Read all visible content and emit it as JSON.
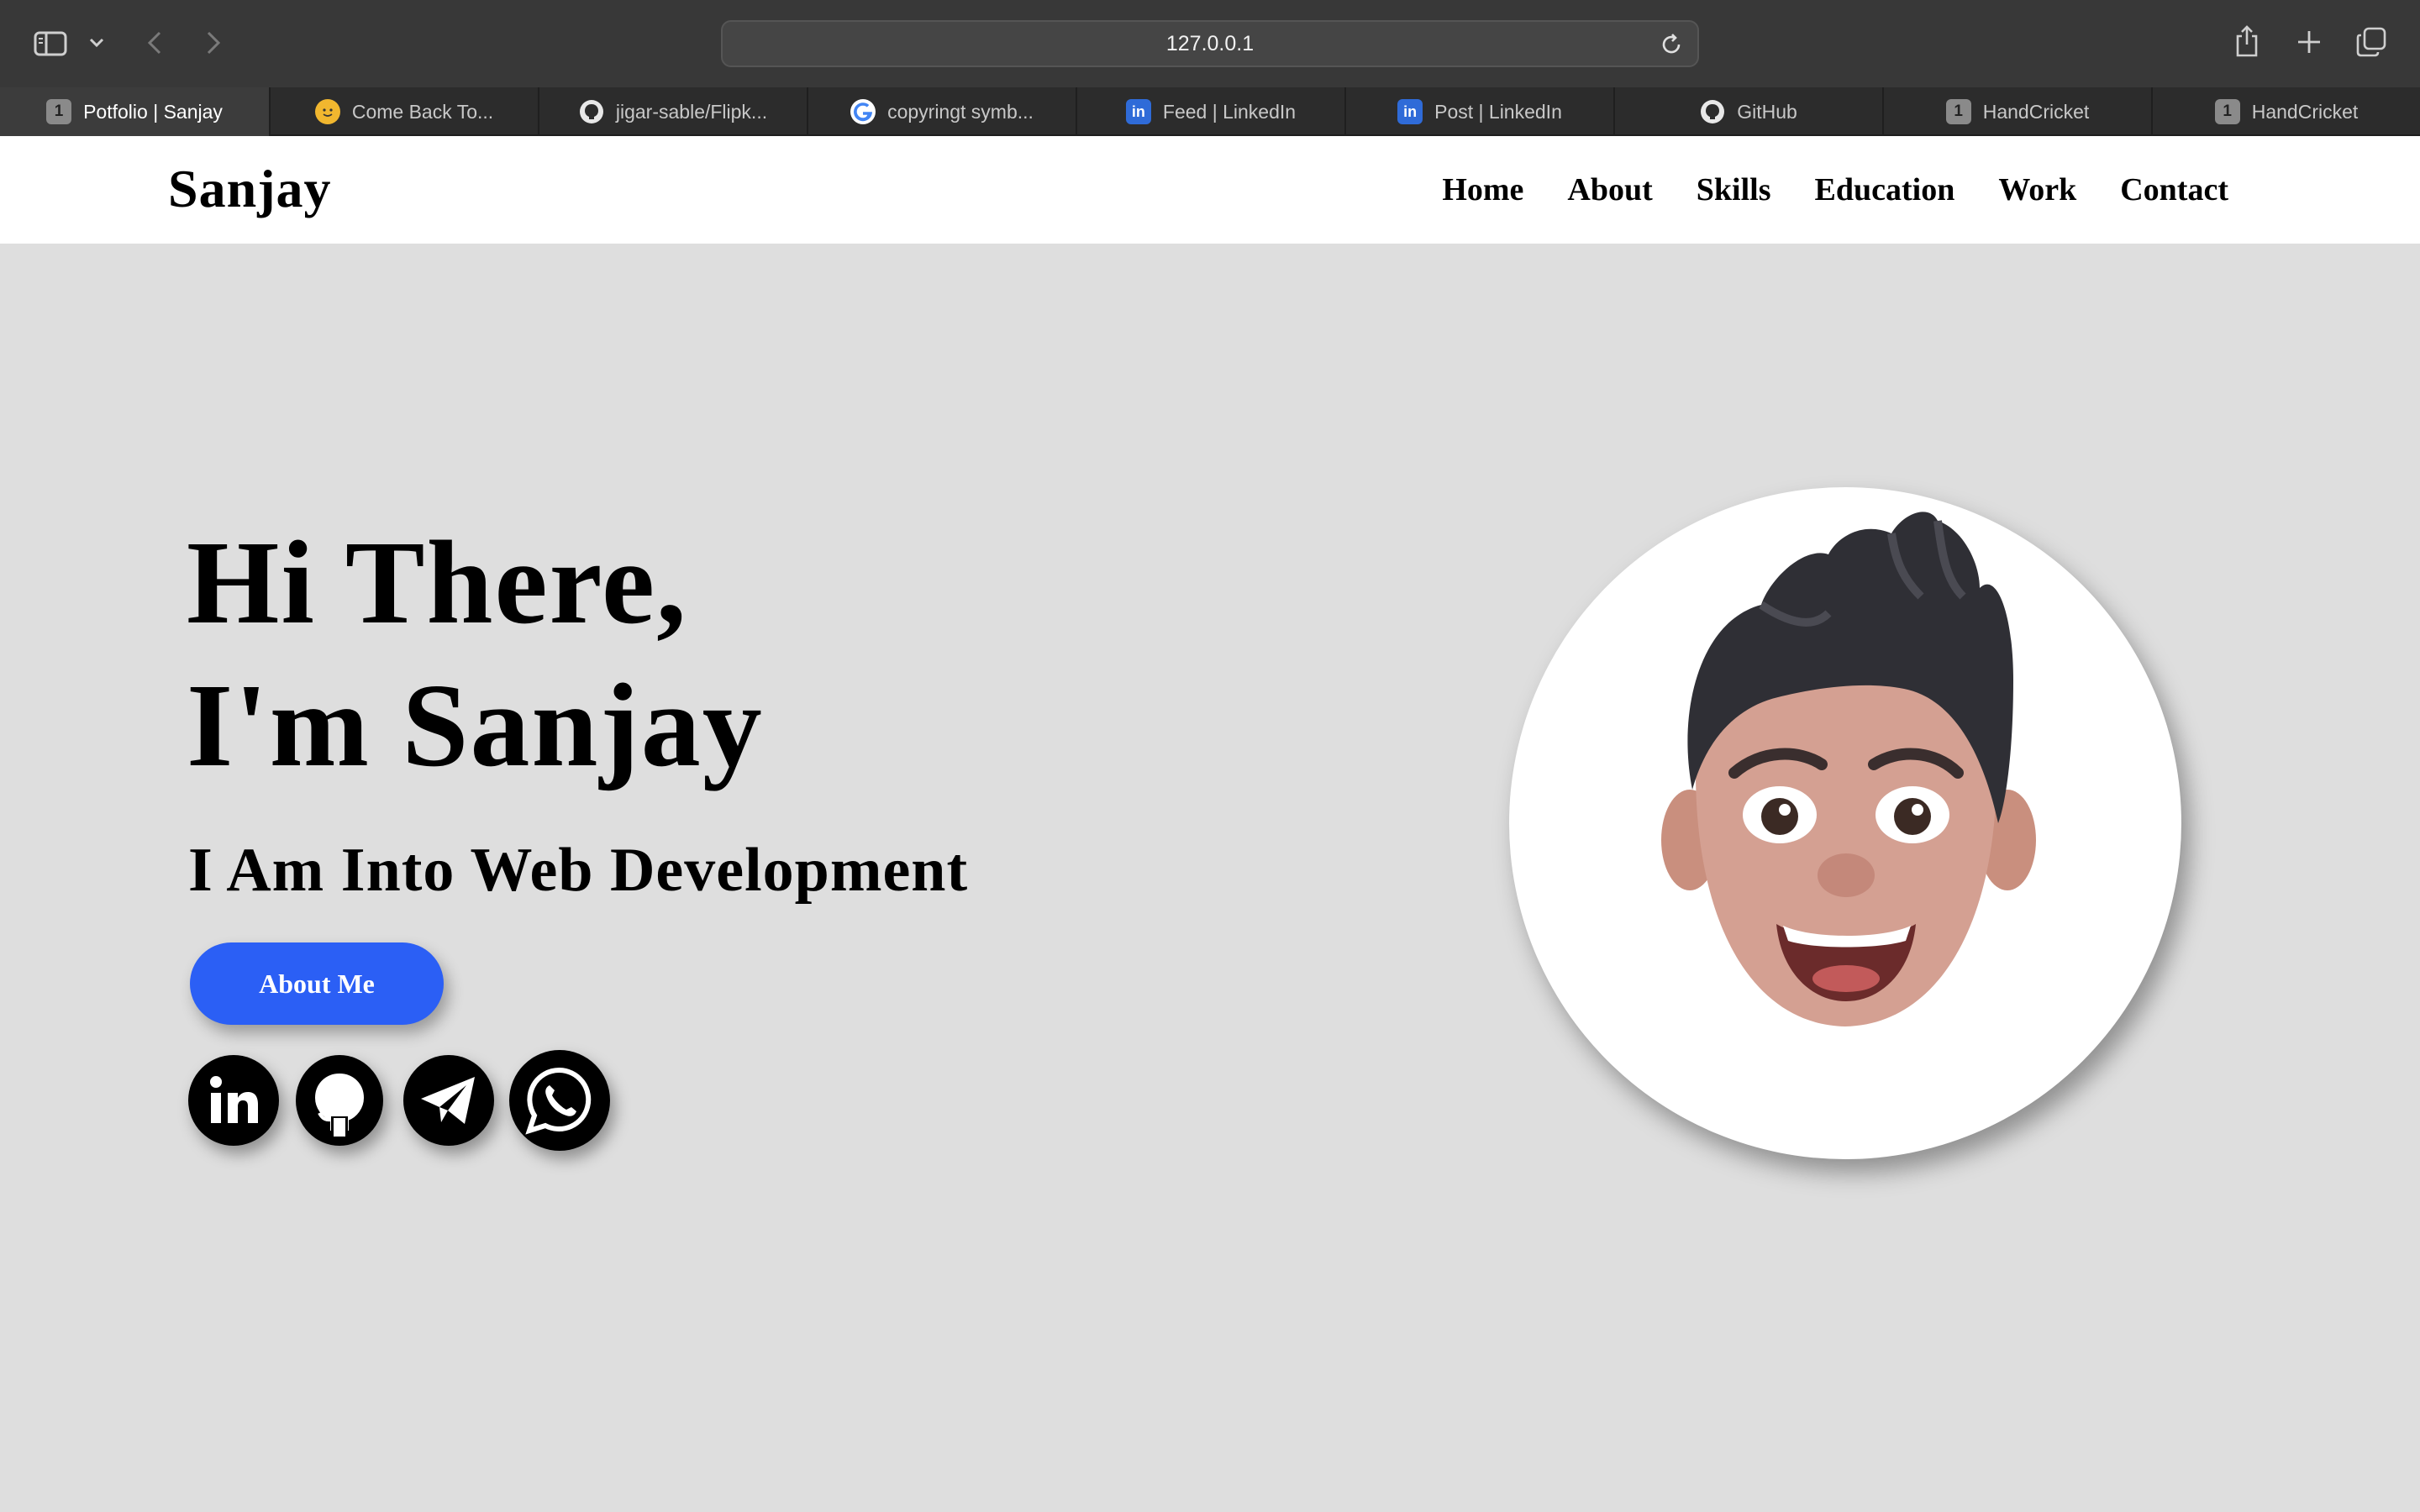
{
  "browser": {
    "url": "127.0.0.1",
    "tabs": [
      {
        "label": "Potfolio | Sanjay",
        "favicon": "1",
        "active": true
      },
      {
        "label": "Come Back To...",
        "favicon": "emoji"
      },
      {
        "label": "jigar-sable/Flipk...",
        "favicon": "github"
      },
      {
        "label": "copyringt symb...",
        "favicon": "google"
      },
      {
        "label": "Feed | LinkedIn",
        "favicon": "in"
      },
      {
        "label": "Post | LinkedIn",
        "favicon": "in"
      },
      {
        "label": "GitHub",
        "favicon": "github"
      },
      {
        "label": "HandCricket",
        "favicon": "1"
      },
      {
        "label": "HandCricket",
        "favicon": "1"
      }
    ]
  },
  "header": {
    "logo": "Sanjay",
    "nav": [
      "Home",
      "About",
      "Skills",
      "Education",
      "Work",
      "Contact"
    ]
  },
  "hero": {
    "title_line1": "Hi There,",
    "title_line2": "I'm Sanjay",
    "subtitle": "I Am Into Web Development",
    "button": "About Me",
    "button_color": "#2b5ff5",
    "social_icons": [
      "linkedin-icon",
      "github-icon",
      "telegram-icon",
      "whatsapp-icon"
    ]
  },
  "colors": {
    "page_bg": "#dedede",
    "header_bg": "#ffffff",
    "text": "#000000"
  }
}
